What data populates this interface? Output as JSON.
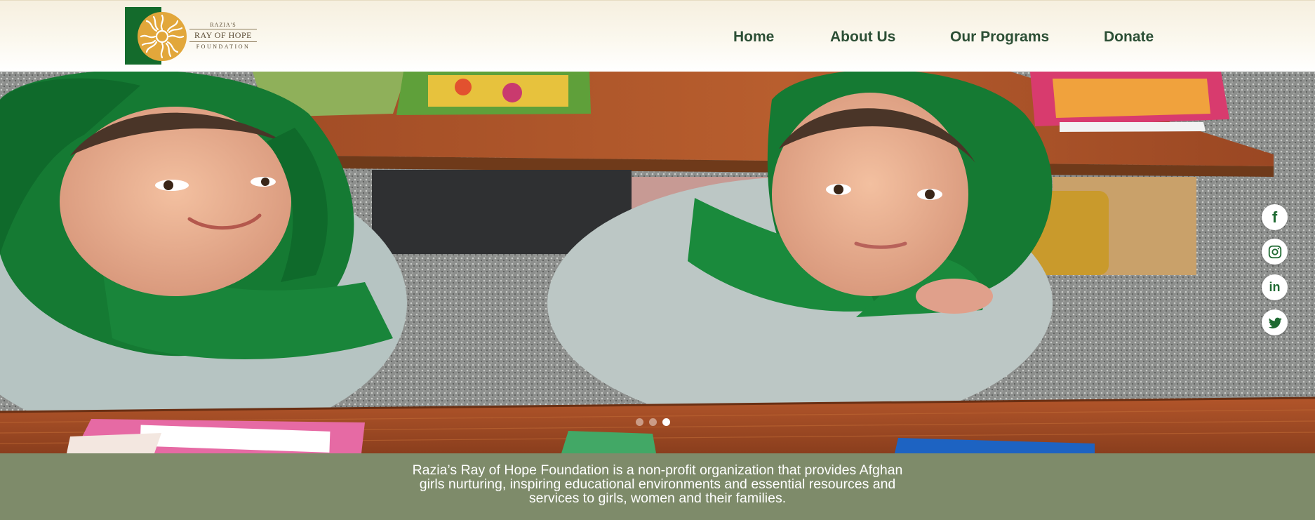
{
  "brand": {
    "logo_line1": "RAZIA'S",
    "logo_line2": "RAY OF HOPE",
    "logo_line3": "FOUNDATION",
    "primary_green": "#146b2c",
    "gold": "#e2a73b"
  },
  "nav": {
    "items": [
      {
        "label": "Home"
      },
      {
        "label": "About Us"
      },
      {
        "label": "Our Programs"
      },
      {
        "label": "Donate"
      }
    ]
  },
  "hero": {
    "image_description_icon": "photo-of-two-girls-in-green-headscarves",
    "slides_total": 3,
    "active_slide": 3
  },
  "social": [
    {
      "icon": "facebook-icon",
      "glyph": "f"
    },
    {
      "icon": "instagram-icon"
    },
    {
      "icon": "linkedin-icon",
      "glyph": "in"
    },
    {
      "icon": "twitter-icon"
    }
  ],
  "mission": {
    "text": "Razia’s Ray of Hope Foundation is a non-profit organization that provides Afghan girls nurturing, inspiring educational environments and essential resources and services to girls, women and their families."
  }
}
